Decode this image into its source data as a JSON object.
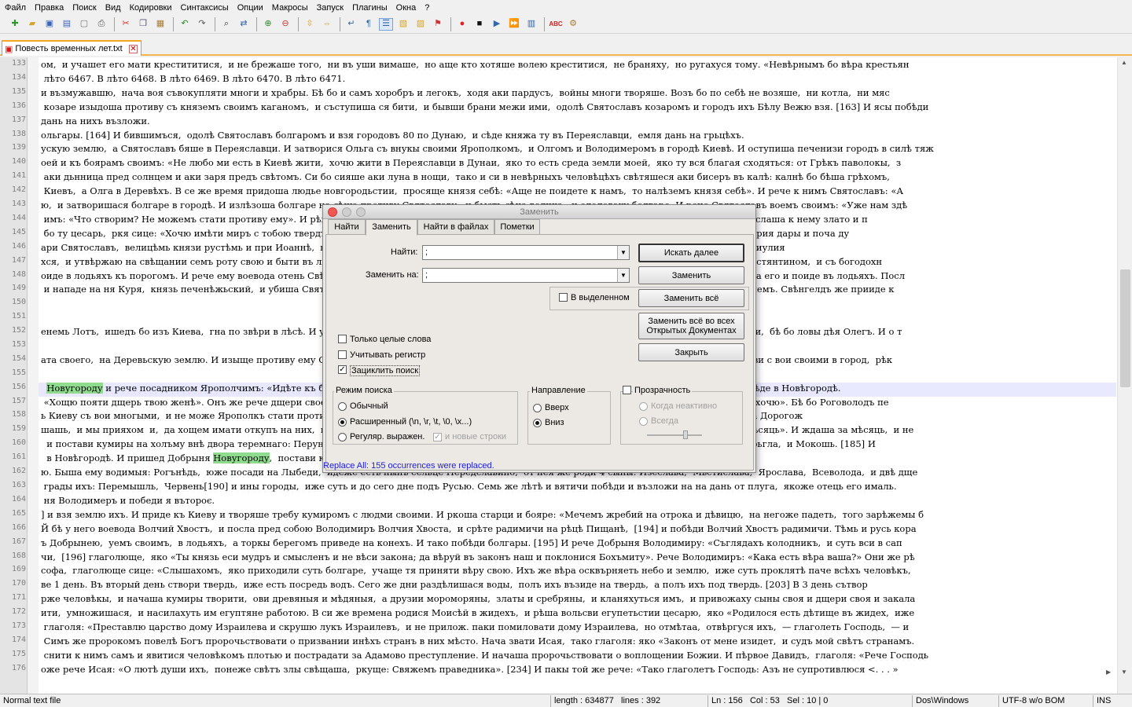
{
  "menu": [
    "Файл",
    "Правка",
    "Поиск",
    "Вид",
    "Кодировки",
    "Синтаксисы",
    "Опции",
    "Макросы",
    "Запуск",
    "Плагины",
    "Окна",
    "?"
  ],
  "tab": {
    "title": "Повесть временных лет.txt"
  },
  "editor": {
    "lines": [
      {
        "n": "133",
        "t": "ом,  и учашет его мати крестититися,  и не брежаше того,  ни въ уши вимаше,  но аще кто хотяше волею креститися,  не браняху,  но ругахуся тому. «Невѣрнымъ бо вѣра крестьян"
      },
      {
        "n": "134",
        "t": " лѣто 6467. В лѣто 6468. В лѣто 6469. В лѣто 6470. В лѣто 6471."
      },
      {
        "n": "135",
        "t": "и възмужавшю,  нача воя съвокупляти многи и храбры. Бѣ бо и самъ хоробръ и легокъ,  ходя аки пардусъ,  войны многи творяше. Возъ бо по себѣ не возяше,  ни котла,  ни мяс"
      },
      {
        "n": "136",
        "t": " козаре изыдоша противу съ княземъ своимъ каганомъ,  и съступиша ся бити,  и бывши брани межи ими,  одолѣ Святославъ козаромъ и городъ ихъ Бѣлу Вежю взя. [163] И ясы побѣди"
      },
      {
        "n": "137",
        "t": "дань на нихъ възложи."
      },
      {
        "n": "138",
        "t": "ольгары. [164] И бившимъся,  одолѣ Святославъ болгаромъ и взя городовъ 80 по Дунаю,  и сѣде княжа ту въ Переяславци,  емля дань на грьцѣхъ."
      },
      {
        "n": "139",
        "t": "ускую землю,  а Святославъ бяше в Переяславци. И затворися Ольга съ внукы своими Ярополкомъ,  и Олгомъ и Володимеромъ в городѣ Киевѣ. И оступиша печенизи городъ в силѣ тяж"
      },
      {
        "n": "140",
        "t": "оей и къ боярамъ своимъ: «Не любо ми есть в Киевѣ жити,  хочю жити в Переяславци в Дунаи,  яко то есть среда земли моей,  яко ту вся благая сходяться: от Грѣкъ паволокы,  з"
      },
      {
        "n": "141",
        "t": " аки дьнница пред солнцем и аки заря предъ свѣтомъ. Си бо сияше аки луна в нощи,  тако и си в невѣрныхъ человѣцѣхъ свѣтяшеся аки бисеръ въ калѣ: калнѣ бо бѣша грѣхомъ,"
      },
      {
        "n": "142",
        "t": " Киевъ,  а Олга в Деревѣхъ. В се же время придоша людье новгородьстии,  просяще князя себѣ: «Аще не поидете к намъ,  то налѣземъ князя себѣ». И рече к нимъ Святославъ: «А"
      },
      {
        "n": "143",
        "t": "ю,  и затворишася болгаре в городѣ. И излѣзоша болгаре на сѣчю противу Святославу,  и бысть сѣча велика,  и одоловаху болгаре. И рече Святославъ воемъ своимъ: «Уже нам здѣ"
      },
      {
        "n": "144",
        "t": " имъ: «Что створим? Не можемъ стати противу ему». И рѣша ему боляре: «Поели к нему дары,  искусимъ,  лю ли есть злату,  или паволокамъ?». Послаша к нему злато и п"
      },
      {
        "n": "145",
        "t": " бо ту цесарь,  ркя сице: «Хочю имѣти миръ с тобою твердъ и любовь». Се же слышавъ,  Святославъ посла къ нему болша пѣрвыхъ. Святославъ же прия дары и поча ду"
      },
      {
        "n": "146",
        "t": "ари Святославъ,  велицѣмь князи рустѣмь и при Иоаннѣ,  нарицаемѣм Цимьскию,  цесарю грѣцькому,  [174] цесарю грѣцкому,  в Дерьстрѣ,  мѣсяца иулия"
      },
      {
        "n": "147",
        "t": "хся,  и утвѣржаю на свѣщании семъ роту свою и быти въ любви со всякимъ царемъ великимъ,  с Василиемъ [175] грѣцькимъ и съ Васильемъ и съ Костянтином,  и съ богодохн"
      },
      {
        "n": "148",
        "t": "оиде в лодьяхъ къ порогомъ. И рече ему воевода отень Свѣнгелдъ: «Поиди,  княже,  на конихъ около,  стоять бо печенѣзи в порозѣхъ». И не послуша его и поиде въ лодьяхъ. Посл"
      },
      {
        "n": "149",
        "t": " и нападе на ня Куря,  князь печенѣжьский,  и убиша Святослава,  и взяша главу его,  и во лбѣ его съдѣлаша чашю,  оковавше лобъ его,  и пьяху в немъ. Свѣнгелдъ же прииде к"
      },
      {
        "n": "150",
        "t": ""
      },
      {
        "n": "151",
        "t": ""
      },
      {
        "n": "152",
        "t": "енемь Лотъ,  ишедъ бо изъ Киева,  гна по звѣри в лѣсѣ. И увидѣ и Олегъ,  и въпроси: «Кто се есть?» И рѣша ему: «Свѣнъделдичь». И,  заѣхавъ,  уби  и,  бѣ бо ловы дѣя Олегъ. И о т"
      },
      {
        "n": "153",
        "t": ""
      },
      {
        "n": "154",
        "t": "ата своего,  на Деревьскую землю. И изыще противу ему Олегъ,  и ополчистася. Ратившимася полкома,  побѣди Ярополкъ Олга. Побѣгшю же Олгови с вои своими в город,  рѣк"
      },
      {
        "n": "155",
        "t": ""
      },
      {
        "n": "156",
        "t": "  Новугороду и рече посадником Ярополчимъ: «Идѣте къ брату моему и рцѣте ему: Володимеръ ти идеть на тя,  пристраивайся противу бится». И сѣде в Новѣгородѣ."
      },
      {
        "n": "157",
        "t": " «Хощю пояти дщерь твою женѣ». Онъ же рече дщери своей: «Хощеши ли за Володимера?» Она же рече: «Не хочю розути робичича,  но Ярополка хочю». Бѣ бо Роговолодъ пе"
      },
      {
        "n": "158",
        "t": "ь Киеву съ вои многыми,  и не може Ярополкъ стати противу,  и затворися Кыевѣ с людми своими и съ Блудомъ; и стояше Володимиръ,  обрыеся на Дорогож"
      },
      {
        "n": "159",
        "t": "шашь,  и мы прияхом  и,  да хощем имати откупъ на них,  по 2 гривнѣ от человѣка». И рече имъ Володимеръ: «Пождѣте,  даже вы куны сберут за мѣсяць». И ждаша за мѣсяць,  и не"
      },
      {
        "n": "160",
        "t": "  и постави кумиры на холъму внѣ двора теремнаго: Перуна древяна,  а главу его сребрену,  а усъ златъ,  и Хърса,  и Дажьбога,  и Стрибога и Сѣмарьгла,  и Мокошь. [185] И"
      },
      {
        "n": "161",
        "t": "  в Новѣгородѣ. И пришед Добрыня Новугороду,  постави кумира надъ рѣкою Волховомъ,  и жряху ему людье новгородстии акы Богу."
      },
      {
        "n": "162",
        "t": "ю. Быша ему водимыя: Рогънѣдь,  юже посади на Лыбеди,  идеже есть нынѣ сельце Передславино,  от нея же роди 4 сыны: Изеслава,  Мьстислава,  Ярослава,  Всеволода,  и двѣ дще"
      },
      {
        "n": "163",
        "t": " грады ихъ: Перемышль,  Червень[190] и ины городы,  иже суть и до сего дне подъ Русью. Семь же лѣтѣ и вятичи побѣди и възложи на на дань от плуга,  якоже отець его ималь."
      },
      {
        "n": "164",
        "t": " ня Володимеръ и победи я вътороє."
      },
      {
        "n": "165",
        "t": "] и взя землю ихъ. И приде къ Киеву и творяше требу кумиромъ с людми своими. И ркоша старци и бояре: «Мечемъ жребий на отрока и дѣвицю,  на негоже падеть,  того зарѣжемы б"
      },
      {
        "n": "166",
        "t": "Й бѣ у него воевода Волчий Хвостъ,  и посла пред собою Володимиръ Волчия Хвоста,  и срѣте радимичи на рѣцѣ Пищанѣ,  [194] и побѣди Волчий Хвостъ радимичи. Тѣмь и русь кора"
      },
      {
        "n": "167",
        "t": "ъ Добрынею,  уемъ своимъ,  в лодьяхъ,  а торкы берегомъ приведе на конехъ. И тако побѣди болгары. [195] И рече Добрыня Володимиру: «Съглядахъ колодникъ,  и суть вси в сап"
      },
      {
        "n": "168",
        "t": "чи,  [196] глаголюще,  яко «Ты князь еси мудръ и смысленъ и не вѣси закона; да вѣруй въ законъ наш и поклонися Бохъмиту». Рече Володимиръ: «Кака есть вѣра ваша?» Они же рѣ"
      },
      {
        "n": "169",
        "t": "софа,  глаголюще сице: «Слышахомъ,  яко приходили суть болгаре,  учаще тя приняти вѣру свою. Ихъ же вѣра осквърняеть небо и землю,  иже суть проклятѣ паче всѣхъ человѣкъ,"
      },
      {
        "n": "170",
        "t": "ве 1 день. Въ вторый день створи твердь,  иже есть посредь водъ. Сего же дни раздѣлишася воды,  полъ ихъ възиде на твердь,  а полъ ихъ под твердь. [203] В 3 день сътвор"
      },
      {
        "n": "171",
        "t": "рже человѣкы,  и начаша кумиры творити,  ови древяныя и мѣдяныя,  а друзии мороморяны,  златы и сребряны,  и кланяхуться имъ,  и привожаху сыны своя и дщери своя и закала"
      },
      {
        "n": "172",
        "t": "ити,  умножишася,  и насилахуть им егуптяне работою. В си же времена родися Моисѣй в жидехъ,  и рѣша вольсви егупетьстии цесарю,  яко «Родилося есть дѣтище въ жидех,  иже"
      },
      {
        "n": "173",
        "t": " глаголя: «Преставлю царство дому Израилева и скрушю лукъ Израилевъ,  и не прилож. паки помиловати дому Израилева,  но отмѣтаа,  отвѣргуся ихъ,  — глаголеть Господь,  — и"
      },
      {
        "n": "174",
        "t": " Симъ же пророкомъ повелѣ Богъ пророчьствовати о призвании инѣхъ странъ в них мѣсто. Нача звати Исая,  тако глаголя: яко «Законъ от мене изидет,  и судъ мой свѣтъ странамъ."
      },
      {
        "n": "175",
        "t": " снити к нимъ самъ и явитися человѣкомъ плотью и пострадати за Адамово преступление. И начаша пророчьствовати о воплощении Божии. И пѣрвое Давидъ,  глаголя: «Рече Господь"
      },
      {
        "n": "176",
        "t": "оже рече Исая: «О лютѣ души ихъ,  понеже свѣтъ злы свѣщаша,  ркуще: Свяжемъ праведника». [234] И пакы той же рече: «Тако глаголетъ Господь: Азъ не супротивлюся <. . . »"
      }
    ]
  },
  "dialog": {
    "title": "Заменить",
    "tabs": [
      "Найти",
      "Заменить",
      "Найти в файлах",
      "Пометки"
    ],
    "find_label": "Найти:",
    "find_value": ";",
    "replace_label": "Заменить на:",
    "replace_value": ";",
    "btn_find_next": "Искать далее",
    "btn_replace": "Заменить",
    "in_selection": "В выделенном",
    "btn_replace_all": "Заменить всё",
    "btn_replace_all_open_1": "Заменить всё во всех",
    "btn_replace_all_open_2": "Открытых Документах",
    "btn_close": "Закрыть",
    "opt_whole_word": "Только целые слова",
    "opt_match_case": "Учитывать регистр",
    "opt_wrap": "Зациклить поиск",
    "search_mode_label": "Режим поиска",
    "mode_normal": "Обычный",
    "mode_extended": "Расширенный (\\n, \\r, \\t, \\0, \\x...)",
    "mode_regex": "Регуляр. выражен.",
    "mode_newline": "и новые строки",
    "direction_label": "Направление",
    "dir_up": "Вверх",
    "dir_down": "Вниз",
    "transparency_label": "Прозрачность",
    "trans_inactive": "Когда неактивно",
    "trans_always": "Всегда",
    "status_msg": "Replace All: 155 occurrences were replaced."
  },
  "status": {
    "filetype": "Normal text file",
    "length": "length : 634877",
    "lines": "lines : 392",
    "ln": "Ln : 156",
    "col": "Col : 53",
    "sel": "Sel : 10 | 0",
    "eol": "Dos\\Windows",
    "enc": "UTF-8 w/o BOM",
    "ins": "INS"
  },
  "colors": {
    "accent_tab": "#f5a623",
    "highlight": "#8fdc8f",
    "status_msg": "#1a1ae6"
  }
}
